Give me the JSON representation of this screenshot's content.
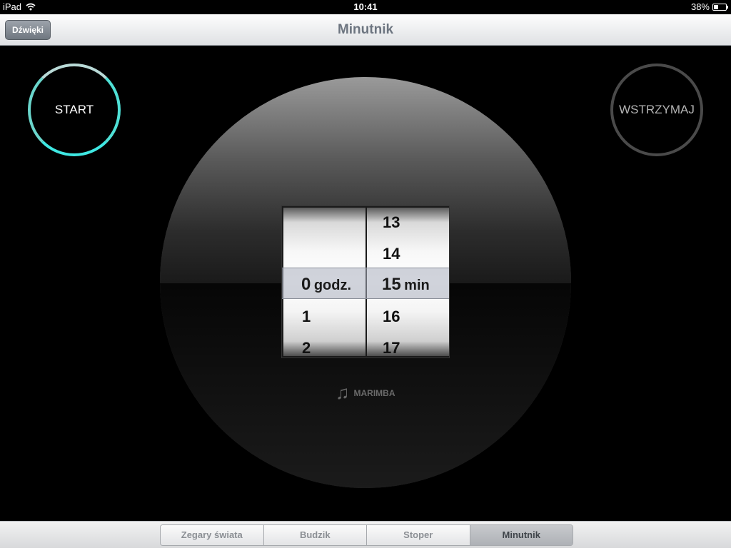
{
  "status_bar": {
    "device": "iPad",
    "time": "10:41",
    "battery_percent": "38%",
    "battery_level": 0.38,
    "wifi_icon": "wifi-icon"
  },
  "nav": {
    "title": "Minutnik",
    "sounds_button": "Dźwięki"
  },
  "controls": {
    "start_label": "START",
    "pause_label": "WSTRZYMAJ",
    "start_color": "#3fe8e3"
  },
  "picker": {
    "hours_above": [
      "",
      ""
    ],
    "hours_selected": "0",
    "hours_unit": "godz.",
    "hours_below": [
      "1",
      "2"
    ],
    "minutes_above": [
      "13",
      "14"
    ],
    "minutes_selected": "15",
    "minutes_unit": "min",
    "minutes_below": [
      "16",
      "17"
    ]
  },
  "sound": {
    "icon": "music-note-icon",
    "name": "MARIMBA"
  },
  "tabs": [
    {
      "label": "Zegary świata",
      "active": false
    },
    {
      "label": "Budzik",
      "active": false
    },
    {
      "label": "Stoper",
      "active": false
    },
    {
      "label": "Minutnik",
      "active": true
    }
  ]
}
